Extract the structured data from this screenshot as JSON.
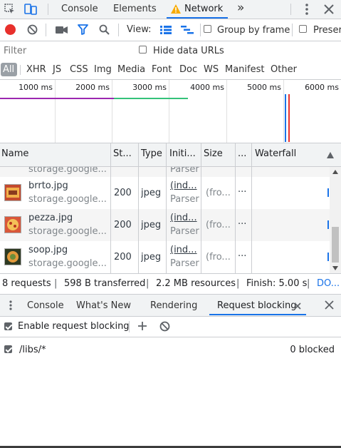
{
  "top_tabs": {
    "console": "Console",
    "elements": "Elements",
    "network": "Network",
    "more": "»"
  },
  "toolbar": {
    "view_label": "View:",
    "group_by_frame": "Group by frame",
    "preserve_log": "Preserv"
  },
  "filter": {
    "placeholder": "Filter",
    "hide_data_urls": "Hide data URLs"
  },
  "types": [
    "All",
    "XHR",
    "JS",
    "CSS",
    "Img",
    "Media",
    "Font",
    "Doc",
    "WS",
    "Manifest",
    "Other"
  ],
  "timeline": {
    "ticks": [
      "1000 ms",
      "2000 ms",
      "3000 ms",
      "4000 ms",
      "5000 ms",
      "6000 ms"
    ]
  },
  "table": {
    "headers": {
      "name": "Name",
      "status": "St...",
      "type": "Type",
      "initiator": "Initi...",
      "size": "Size",
      "time": "...",
      "waterfall": "Waterfall"
    },
    "partial_row": {
      "domain": "storage.google...",
      "initiator_sub": "Parser"
    },
    "rows": [
      {
        "name": "brrto.jpg",
        "domain": "storage.google...",
        "status": "200",
        "type": "jpeg",
        "initiator": "(ind...",
        "initiator_sub": "Parser",
        "size": "(fro...",
        "time": "..."
      },
      {
        "name": "pezza.jpg",
        "domain": "storage.google...",
        "status": "200",
        "type": "jpeg",
        "initiator": "(ind...",
        "initiator_sub": "Parser",
        "size": "(fro...",
        "time": "..."
      },
      {
        "name": "soop.jpg",
        "domain": "storage.google...",
        "status": "200",
        "type": "jpeg",
        "initiator": "(ind...",
        "initiator_sub": "Parser",
        "size": "(fro...",
        "time": "..."
      }
    ]
  },
  "status_bar": {
    "requests": "8 requests",
    "transferred": "598 B transferred",
    "resources": "2.2 MB resources",
    "finish": "Finish: 5.00 s",
    "dom": "DO..."
  },
  "drawer_tabs": {
    "console": "Console",
    "whats_new": "What's New",
    "rendering": "Rendering",
    "request_blocking": "Request blocking"
  },
  "blocking": {
    "enable": "Enable request blocking",
    "pattern": "/libs/*",
    "count": "0 blocked"
  },
  "colors": {
    "accent": "#1a73e8",
    "record": "#e8302c",
    "selected_type": "#9aa0a6"
  }
}
